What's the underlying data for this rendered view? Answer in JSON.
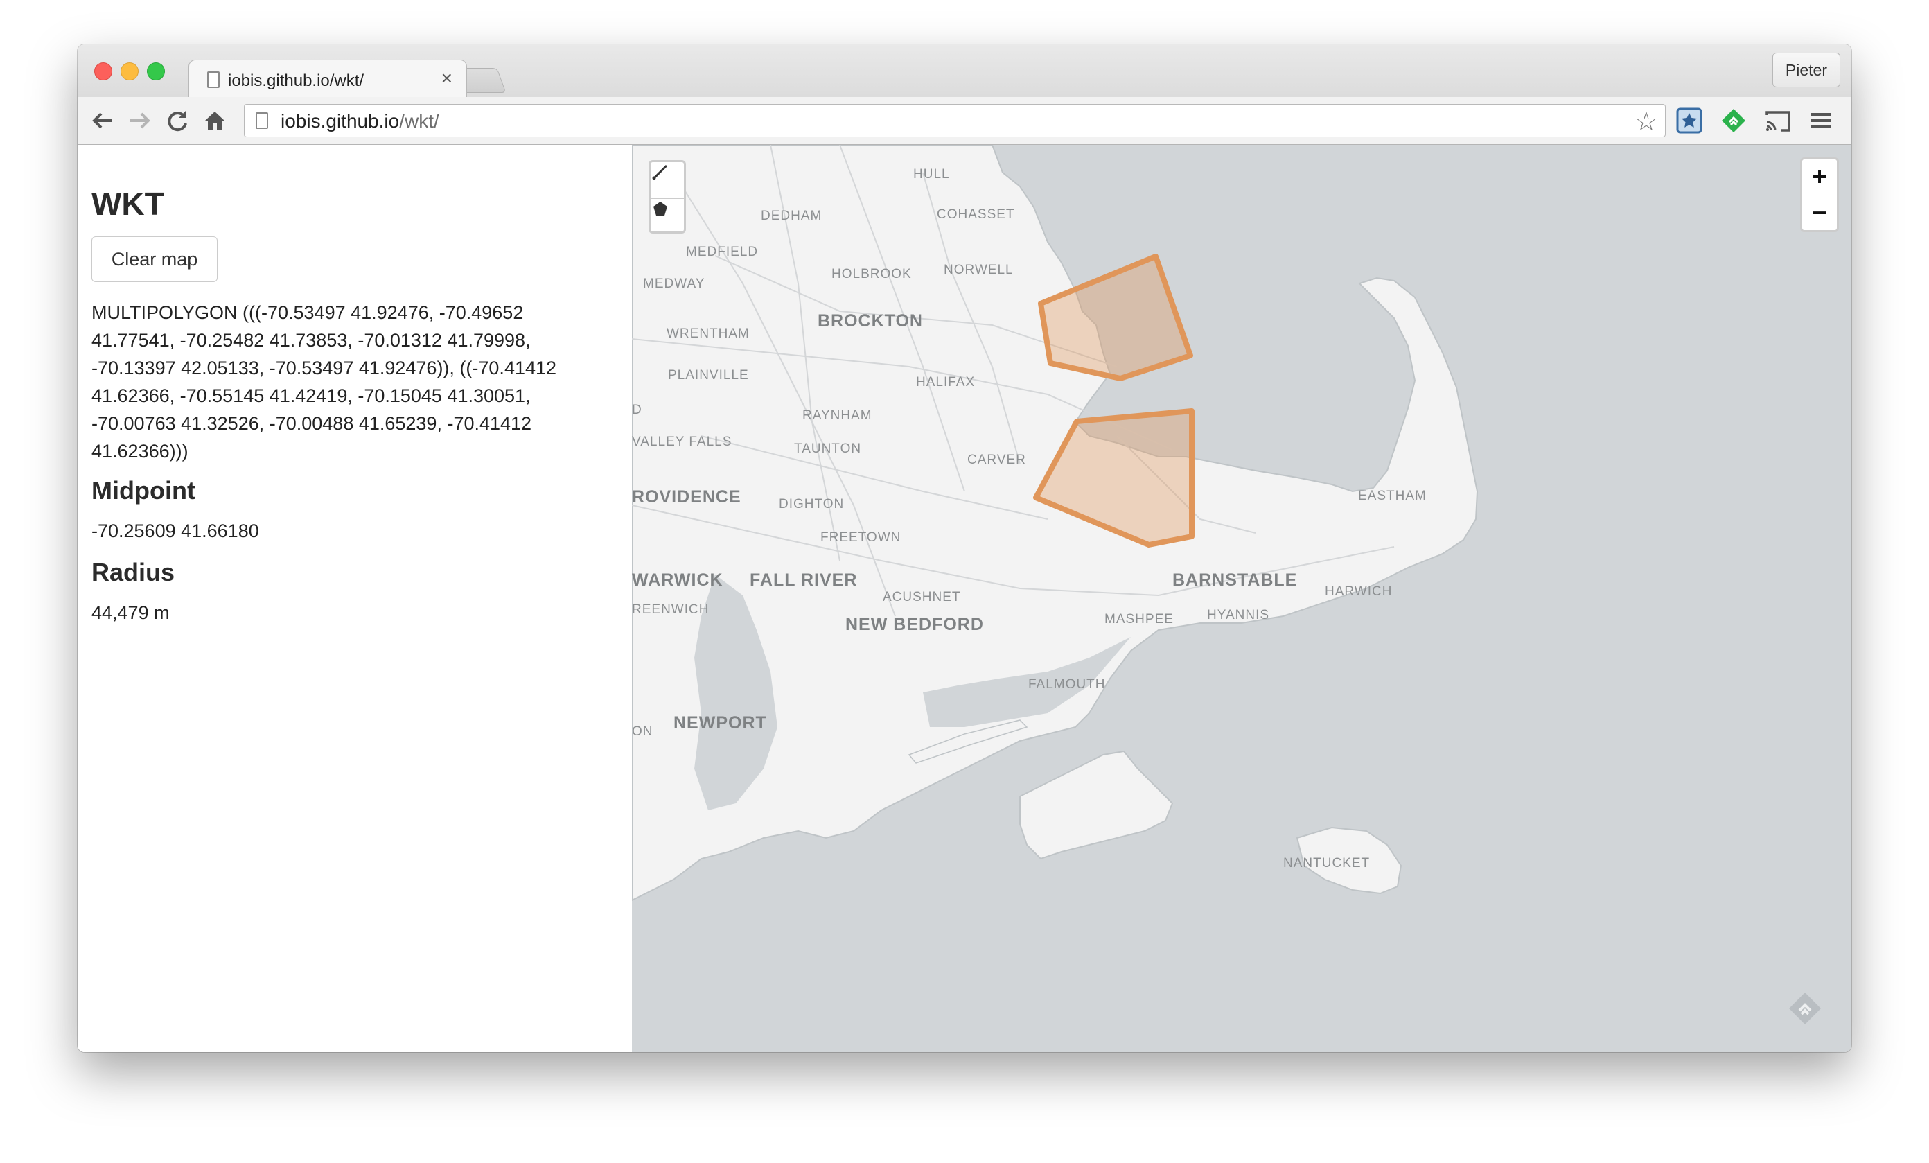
{
  "browser": {
    "tab_title": "iobis.github.io/wkt/",
    "tab_close": "×",
    "profile_name": "Pieter",
    "url_host": "iobis.github.io",
    "url_path": "/wkt/"
  },
  "panel": {
    "heading": "WKT",
    "clear_button": "Clear map",
    "wkt": "MULTIPOLYGON (((-70.53497 41.92476, -70.49652 41.77541, -70.25482 41.73853, -70.01312 41.79998, -70.13397 42.05133, -70.53497 41.92476)), ((-70.41412 41.62366, -70.55145 41.42419, -70.15045 41.30051, -70.00763 41.32526, -70.00488 41.65239, -70.41412 41.62366)))",
    "midpoint_heading": "Midpoint",
    "midpoint_value": "-70.25609 41.66180",
    "radius_heading": "Radius",
    "radius_value": "44,479 m"
  },
  "map": {
    "zoom_in": "+",
    "zoom_out": "−",
    "polygon_color": "#e0965a",
    "labels": {
      "hull": "HULL",
      "dedham": "DEDHAM",
      "cohasset": "COHASSET",
      "medfield": "MEDFIELD",
      "holbrook": "HOLBROOK",
      "norwell": "NORWELL",
      "medway": "MEDWAY",
      "brockton": "BROCKTON",
      "wrentham": "WRENTHAM",
      "plainville": "PLAINVILLE",
      "halifax": "HALIFAX",
      "raynham": "RAYNHAM",
      "valley_falls": "VALLEY FALLS",
      "taunton": "TAUNTON",
      "carver": "CARVER",
      "providence": "ROVIDENCE",
      "dighton": "DIGHTON",
      "eastham": "EASTHAM",
      "freetown": "FREETOWN",
      "warwick": "WARWICK",
      "fall_river": "FALL RIVER",
      "barnstable": "BARNSTABLE",
      "harwich": "HARWICH",
      "greenwich": "REENWICH",
      "acushnet": "ACUSHNET",
      "mashpee": "MASHPEE",
      "hyannis": "HYANNIS",
      "new_bedford": "NEW BEDFORD",
      "falmouth": "FALMOUTH",
      "newport": "NEWPORT",
      "on": "ON",
      "nantucket": "NANTUCKET",
      "d": "D"
    }
  }
}
